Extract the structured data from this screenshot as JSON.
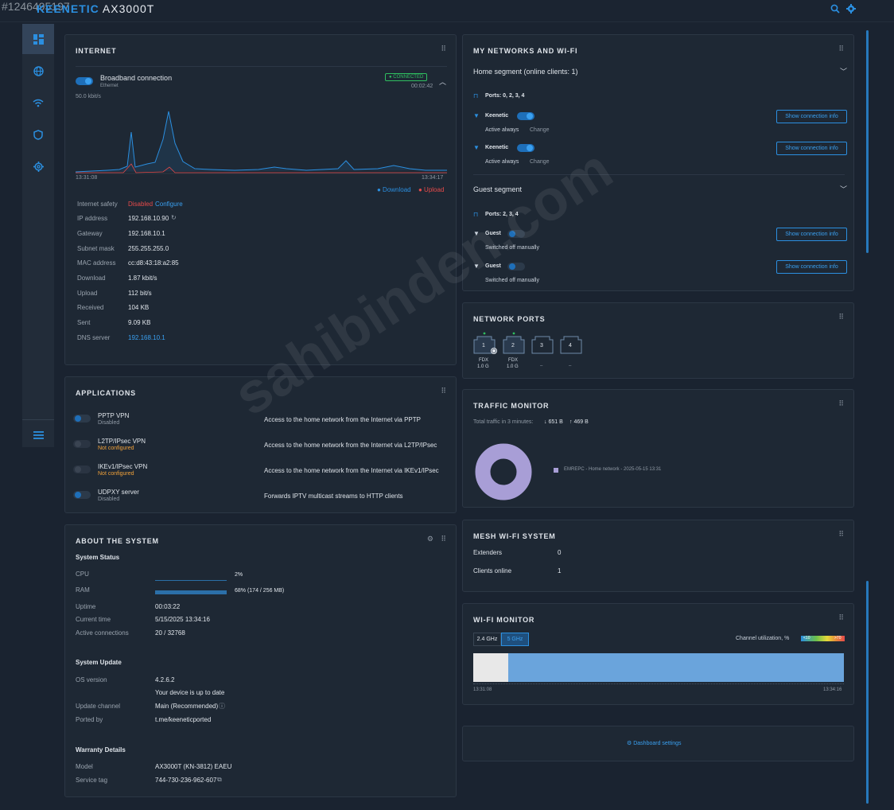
{
  "watermark_id": "#1246495197",
  "brand": {
    "part1": "KEENETIC",
    "part2": "AX3000T"
  },
  "topbar": {
    "search_icon": "search-icon",
    "settings_icon": "gear-icon"
  },
  "sidebar": {
    "items": [
      {
        "icon": "dashboard-icon",
        "active": true
      },
      {
        "icon": "globe-icon"
      },
      {
        "icon": "wifi-icon"
      },
      {
        "icon": "shield-icon"
      },
      {
        "icon": "settings-gear-icon"
      }
    ],
    "menu_icon": "menu-icon"
  },
  "internet": {
    "title": "INTERNET",
    "connection_name": "Broadband connection",
    "connection_type": "Ethernet",
    "status": "● CONNECTED",
    "uptime": "00:02:42",
    "speed": "50.0 kbit/s",
    "chart_start": "13:31:08",
    "chart_end": "13:34:17",
    "legend_download": "● Download",
    "legend_upload": "● Upload",
    "rows": [
      {
        "label": "Internet safety",
        "value": "Disabled",
        "extra": "Configure"
      },
      {
        "label": "IP address",
        "value": "192.168.10.90"
      },
      {
        "label": "Gateway",
        "value": "192.168.10.1"
      },
      {
        "label": "Subnet mask",
        "value": "255.255.255.0"
      },
      {
        "label": "MAC address",
        "value": "cc:d8:43:18:a2:85"
      },
      {
        "label": "Download",
        "value": "1.87 kbit/s"
      },
      {
        "label": "Upload",
        "value": "112 bit/s"
      },
      {
        "label": "Received",
        "value": "104 KB"
      },
      {
        "label": "Sent",
        "value": "9.09 KB"
      },
      {
        "label": "DNS server",
        "value": "192.168.10.1"
      }
    ]
  },
  "networks": {
    "title": "MY NETWORKS AND WI-FI",
    "home_segment": "Home segment (online clients: 1)",
    "home_ports": "Ports: 0, 2, 3, 4",
    "home_wifi": [
      {
        "name": "Keenetic",
        "status": "Active always",
        "change": "Change",
        "button": "Show connection info"
      },
      {
        "name": "Keenetic",
        "status": "Active always",
        "change": "Change",
        "button": "Show connection info"
      }
    ],
    "guest_segment": "Guest segment",
    "guest_ports": "Ports: 2, 3, 4",
    "guest_wifi": [
      {
        "name": "Guest",
        "status": "Switched off manually",
        "button": "Show connection info"
      },
      {
        "name": "Guest",
        "status": "Switched off manually",
        "button": "Show connection info"
      }
    ]
  },
  "ports": {
    "title": "NETWORK PORTS",
    "items": [
      {
        "num": "1",
        "duplex": "FDX",
        "speed": "1.0 G"
      },
      {
        "num": "2",
        "duplex": "FDX",
        "speed": "1.0 G"
      },
      {
        "num": "3",
        "duplex": "",
        "speed": "–"
      },
      {
        "num": "4",
        "duplex": "",
        "speed": "–"
      }
    ]
  },
  "applications": {
    "title": "APPLICATIONS",
    "items": [
      {
        "name": "PPTP VPN",
        "status": "Disabled",
        "desc": "Access to the home network from the Internet via PPTP"
      },
      {
        "name": "L2TP/IPsec VPN",
        "status": "Not configured",
        "desc": "Access to the home network from the Internet via L2TP/IPsec"
      },
      {
        "name": "IKEv1/IPsec VPN",
        "status": "Not configured",
        "desc": "Access to the home network from the Internet via IKEv1/IPsec"
      },
      {
        "name": "UDPXY server",
        "status": "Disabled",
        "desc": "Forwards IPTV multicast streams to HTTP clients"
      }
    ]
  },
  "traffic": {
    "title": "TRAFFIC MONITOR",
    "summary_label": "Total traffic in 3 minutes:",
    "down": "↓ 651 B",
    "up": "↑ 469 B",
    "legend": "EMREPC - Home network - 2025-05-15 13:31"
  },
  "system": {
    "title": "ABOUT THE SYSTEM",
    "status_heading": "System Status",
    "cpu_label": "CPU",
    "cpu_value": "2%",
    "cpu_level": 0.02,
    "ram_label": "RAM",
    "ram_value": "68% (174 / 256 MB)",
    "ram_level": 0.68,
    "rows": [
      {
        "label": "Uptime",
        "value": "00:03:22"
      },
      {
        "label": "Current time",
        "value": "5/15/2025 13:34:16"
      },
      {
        "label": "Active connections",
        "value": "20 / 32768"
      }
    ],
    "update_heading": "System Update",
    "os_label": "OS version",
    "os_value": "4.2.6.2",
    "os_note": "Your device is up to date",
    "channel_label": "Update channel",
    "channel_value": "Main (Recommended)",
    "ported_label": "Ported by",
    "ported_value": "t.me/keeneticported",
    "warranty_heading": "Warranty Details",
    "model_label": "Model",
    "model_value": "AX3000T (KN-3812) EAEU",
    "tag_label": "Service tag",
    "tag_value": "744-730-236-962-607"
  },
  "mesh": {
    "title": "MESH WI-FI SYSTEM",
    "extenders_label": "Extenders",
    "extenders_value": "0",
    "clients_label": "Clients online",
    "clients_value": "1"
  },
  "wifi_monitor": {
    "title": "WI-FI MONITOR",
    "tab_24": "2.4 GHz",
    "tab_5": "5 GHz",
    "util_label": "Channel utilization, %",
    "scale_low": "<10",
    "scale_high": ">70",
    "start": "13:31:08",
    "end": "13:34:16"
  },
  "dashboard_settings": "Dashboard settings",
  "overlay_watermark": "sahibinden.com",
  "colors": {
    "accent": "#2b8fe0",
    "connected": "#2fbf60",
    "disabled": "#e64a4a",
    "warning": "#f2a23a"
  }
}
